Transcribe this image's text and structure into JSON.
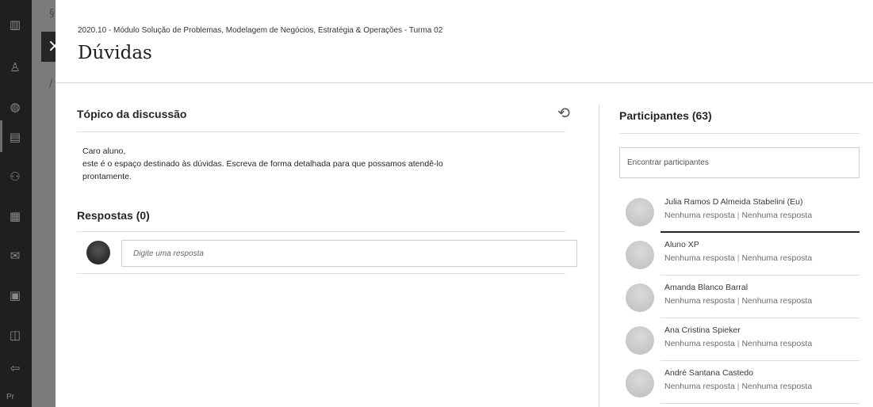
{
  "rail": {
    "icons": [
      "building-icon",
      "user-icon",
      "globe-icon",
      "courses-icon",
      "groups-icon",
      "calendar-icon",
      "messages-icon",
      "grades-icon",
      "tools-icon",
      "signout-icon"
    ],
    "footer_text": "Pr"
  },
  "close_glyph": "×",
  "header": {
    "breadcrumb": "2020.10 - Módulo Solução de Problemas, Modelagem de Negócios, Estratégia & Operações - Turma 02",
    "title": "Dúvidas"
  },
  "topic": {
    "title": "Tópico da discussão",
    "refresh_glyph": "⟲",
    "lines": [
      "Caro aluno,",
      "este é o espaço destinado às dúvidas. Escreva de forma detalhada para que possamos atendê-lo",
      "prontamente."
    ]
  },
  "responses": {
    "title": "Respostas (0)",
    "reply_placeholder": "Digite uma resposta"
  },
  "participants": {
    "title": "Participantes (63)",
    "search_placeholder": "Encontrar participantes",
    "items": [
      {
        "name": "Julia Ramos D Almeida Stabelini (Eu)",
        "status_a": "Nenhuma resposta",
        "status_b": "Nenhuma resposta"
      },
      {
        "name": "Aluno XP",
        "status_a": "Nenhuma resposta",
        "status_b": "Nenhuma resposta"
      },
      {
        "name": "Amanda Blanco Barral",
        "status_a": "Nenhuma resposta",
        "status_b": "Nenhuma resposta"
      },
      {
        "name": "Ana Cristina Spieker",
        "status_a": "Nenhuma resposta",
        "status_b": "Nenhuma resposta"
      },
      {
        "name": "André Santana Castedo",
        "status_a": "Nenhuma resposta",
        "status_b": "Nenhuma resposta"
      }
    ],
    "separator": "|"
  }
}
